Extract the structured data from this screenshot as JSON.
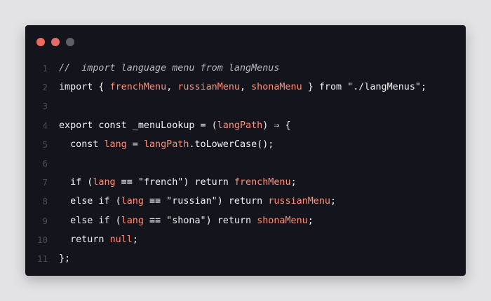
{
  "window": {
    "dot_colors": [
      "#ec6a5e",
      "#e46c6c",
      "#5e6066"
    ]
  },
  "code": {
    "lines": [
      {
        "n": "1",
        "tokens": [
          {
            "t": "//  import language menu from langMenus",
            "c": "comment"
          }
        ]
      },
      {
        "n": "2",
        "tokens": [
          {
            "t": "import { ",
            "c": "kw"
          },
          {
            "t": "frenchMenu",
            "c": "var"
          },
          {
            "t": ", ",
            "c": "id"
          },
          {
            "t": "russianMenu",
            "c": "var"
          },
          {
            "t": ", ",
            "c": "id"
          },
          {
            "t": "shonaMenu",
            "c": "var"
          },
          {
            "t": " } from \"./langMenus\";",
            "c": "kw"
          }
        ]
      },
      {
        "n": "3",
        "tokens": []
      },
      {
        "n": "4",
        "tokens": [
          {
            "t": "export const _menuLookup = (",
            "c": "kw"
          },
          {
            "t": "langPath",
            "c": "var"
          },
          {
            "t": ") ⇒ {",
            "c": "op"
          }
        ]
      },
      {
        "n": "5",
        "tokens": [
          {
            "t": "  const ",
            "c": "kw"
          },
          {
            "t": "lang",
            "c": "var"
          },
          {
            "t": " = ",
            "c": "op"
          },
          {
            "t": "langPath",
            "c": "var"
          },
          {
            "t": ".toLowerCase();",
            "c": "id"
          }
        ]
      },
      {
        "n": "6",
        "tokens": []
      },
      {
        "n": "7",
        "tokens": [
          {
            "t": "  if (",
            "c": "kw"
          },
          {
            "t": "lang",
            "c": "var"
          },
          {
            "t": " ≡≡ \"french\") return ",
            "c": "op"
          },
          {
            "t": "frenchMenu",
            "c": "var"
          },
          {
            "t": ";",
            "c": "id"
          }
        ]
      },
      {
        "n": "8",
        "tokens": [
          {
            "t": "  else if (",
            "c": "kw"
          },
          {
            "t": "lang",
            "c": "var"
          },
          {
            "t": " ≡≡ \"russian\") return ",
            "c": "op"
          },
          {
            "t": "russianMenu",
            "c": "var"
          },
          {
            "t": ";",
            "c": "id"
          }
        ]
      },
      {
        "n": "9",
        "tokens": [
          {
            "t": "  else if (",
            "c": "kw"
          },
          {
            "t": "lang",
            "c": "var"
          },
          {
            "t": " ≡≡ \"shona\") return ",
            "c": "op"
          },
          {
            "t": "shonaMenu",
            "c": "var"
          },
          {
            "t": ";",
            "c": "id"
          }
        ]
      },
      {
        "n": "10",
        "tokens": [
          {
            "t": "  return ",
            "c": "kw"
          },
          {
            "t": "null",
            "c": "var"
          },
          {
            "t": ";",
            "c": "id"
          }
        ]
      },
      {
        "n": "11",
        "tokens": [
          {
            "t": "};",
            "c": "id"
          }
        ]
      }
    ]
  }
}
